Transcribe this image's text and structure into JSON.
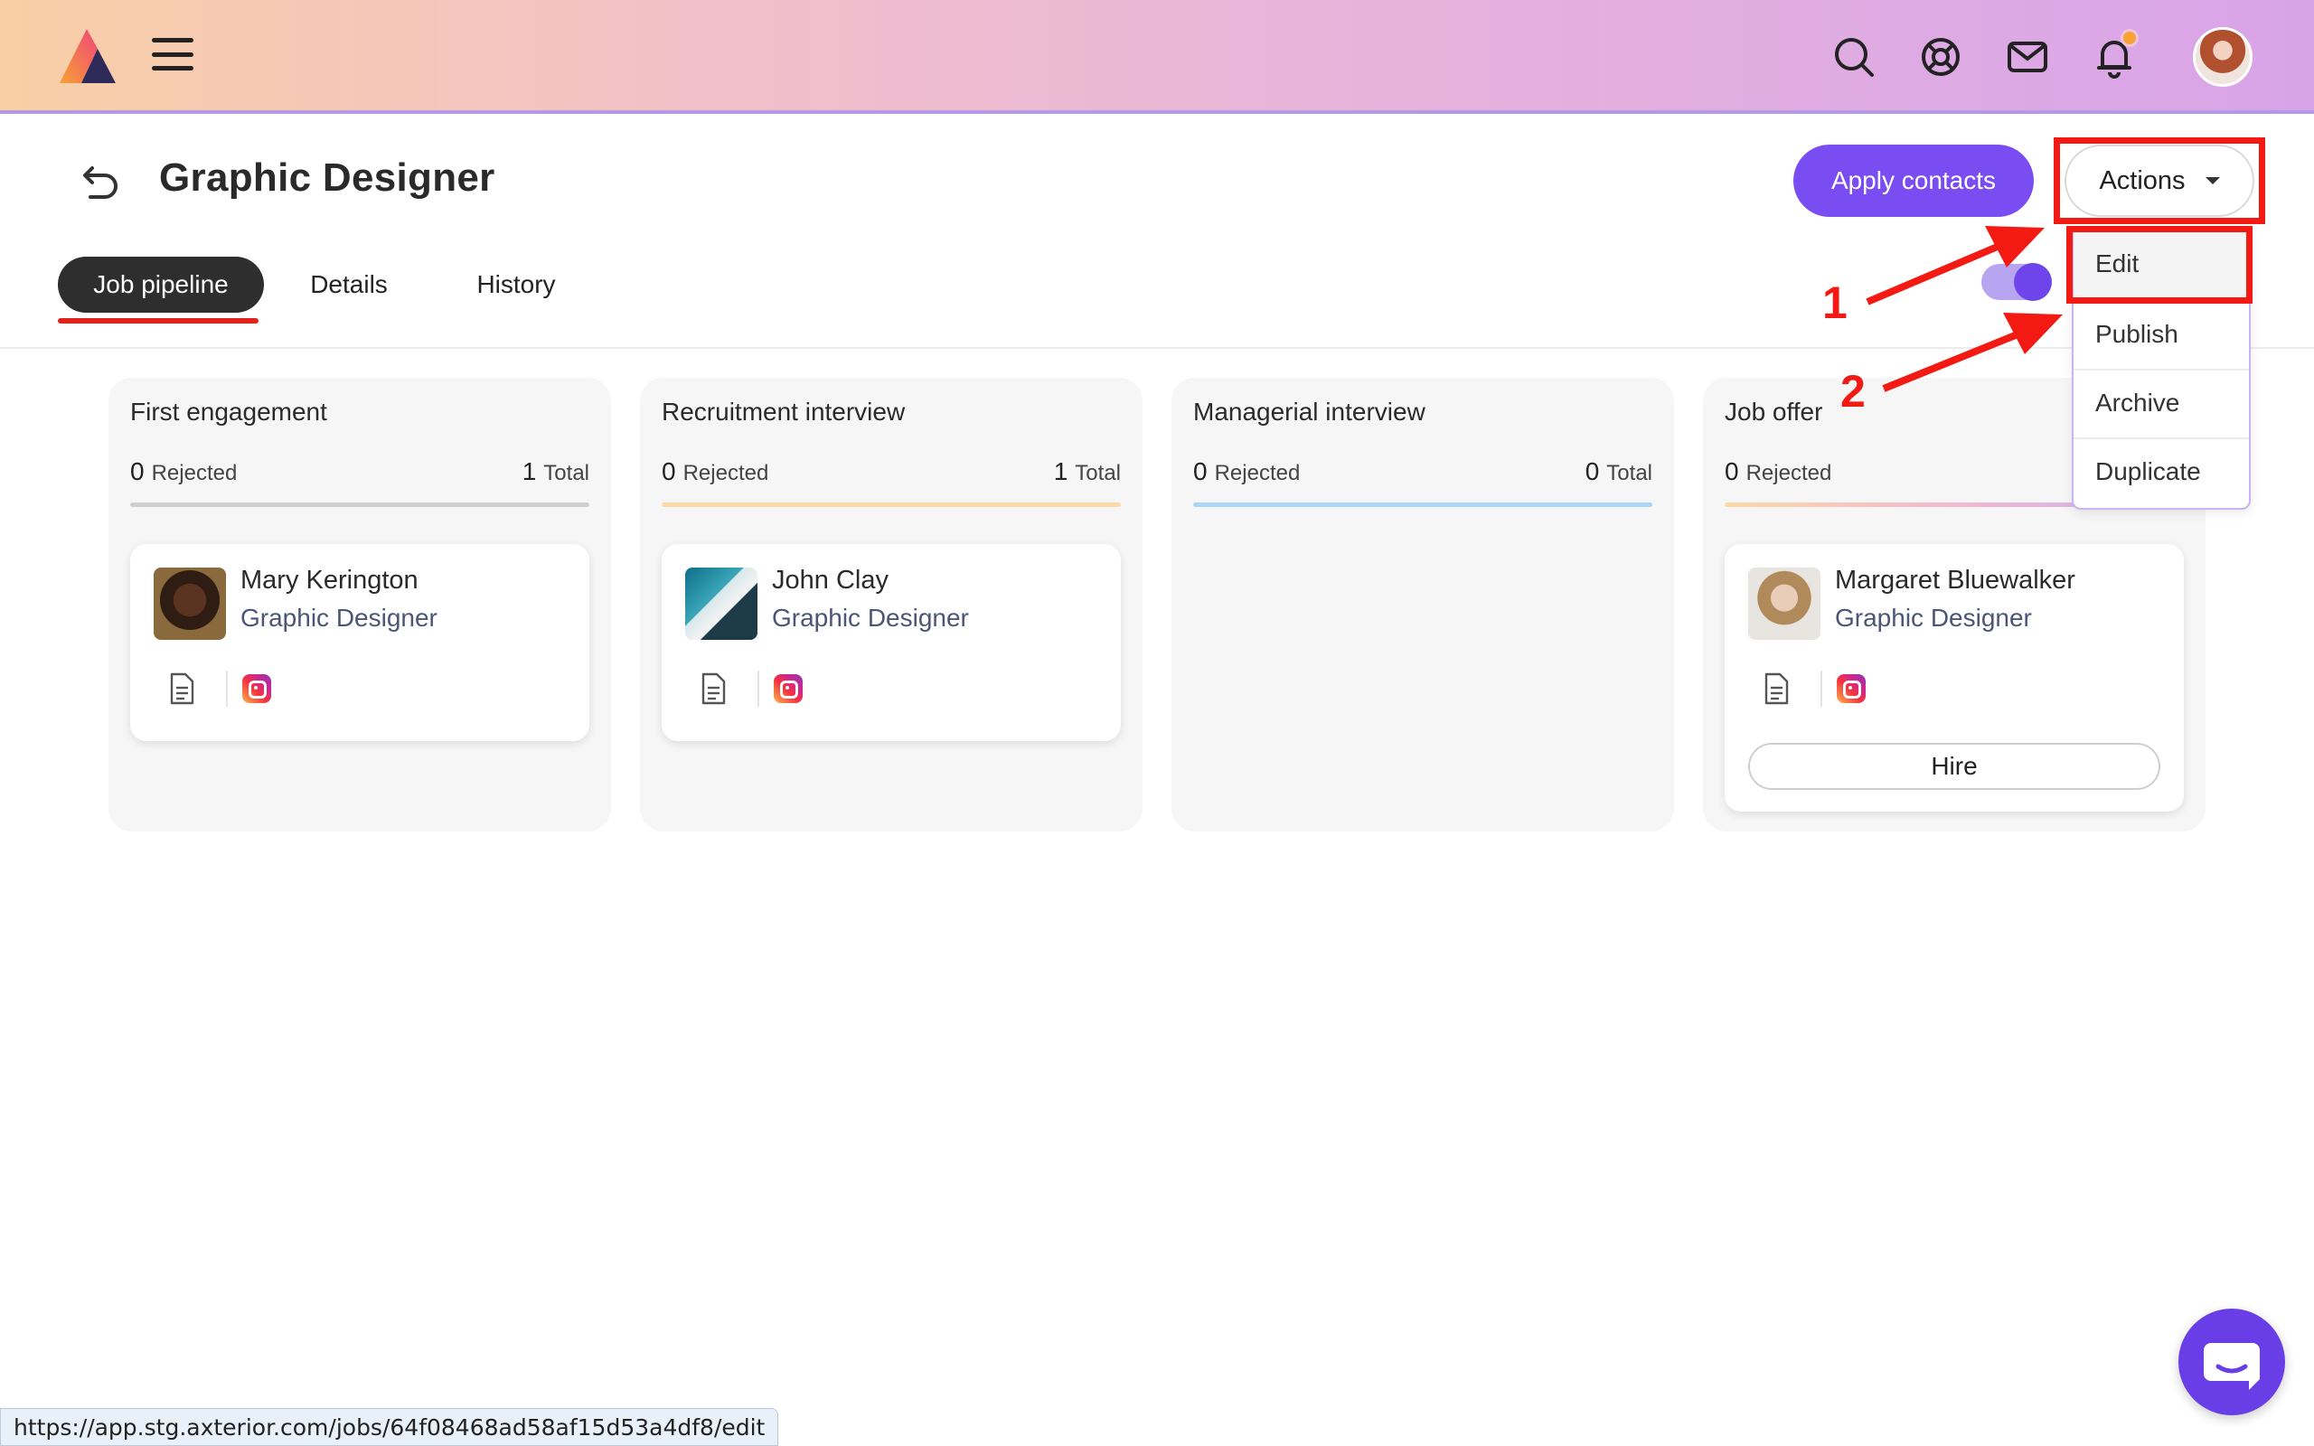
{
  "app": {
    "icons": [
      "app-logo",
      "menu-icon",
      "search-icon",
      "support-icon",
      "mail-icon",
      "bell-icon",
      "user-avatar"
    ],
    "colors": {
      "accent": "#7a4df2",
      "annotation": "#f21a12",
      "notification": "#f7a233"
    }
  },
  "header": {
    "title": "Graphic Designer",
    "apply_label": "Apply contacts",
    "actions_label": "Actions"
  },
  "tabs": [
    {
      "label": "Job pipeline",
      "active": true
    },
    {
      "label": "Details",
      "active": false
    },
    {
      "label": "History",
      "active": false
    }
  ],
  "columns": [
    {
      "title": "First engagement",
      "rejected_count": "0",
      "rejected_label": "Rejected",
      "total_count": "1",
      "total_label": "Total",
      "bar_color": "#cfcfcf",
      "candidates": [
        {
          "name": "Mary Kerington",
          "role": "Graphic Designer"
        }
      ]
    },
    {
      "title": "Recruitment interview",
      "rejected_count": "0",
      "rejected_label": "Rejected",
      "total_count": "1",
      "total_label": "Total",
      "bar_color": "#fbd9a8",
      "candidates": [
        {
          "name": "John Clay",
          "role": "Graphic Designer"
        }
      ]
    },
    {
      "title": "Managerial interview",
      "rejected_count": "0",
      "rejected_label": "Rejected",
      "total_count": "0",
      "total_label": "Total",
      "bar_color": "#a9d6f5",
      "candidates": []
    },
    {
      "title": "Job offer",
      "rejected_count": "0",
      "rejected_label": "Rejected",
      "total_count": "",
      "total_label": "",
      "bar_color": "#f2b8d0",
      "candidates": [
        {
          "name": "Margaret Bluewalker",
          "role": "Graphic Designer",
          "hire_label": "Hire"
        }
      ]
    }
  ],
  "dropdown": {
    "items": [
      "Edit",
      "Publish",
      "Archive",
      "Duplicate"
    ]
  },
  "annotations": {
    "step1": "1",
    "step2": "2"
  },
  "status_bar": {
    "url": "https://app.stg.axterior.com/jobs/64f08468ad58af15d53a4df8/edit"
  }
}
